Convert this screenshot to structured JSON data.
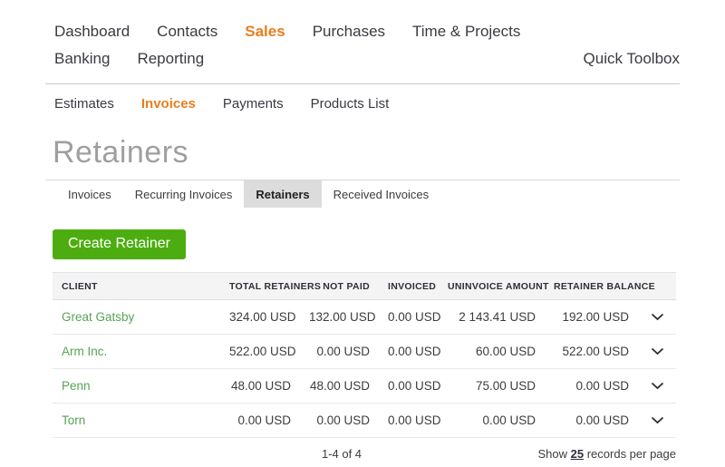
{
  "nav": {
    "row1": [
      {
        "label": "Dashboard",
        "active": false
      },
      {
        "label": "Contacts",
        "active": false
      },
      {
        "label": "Sales",
        "active": true
      },
      {
        "label": "Purchases",
        "active": false
      },
      {
        "label": "Time & Projects",
        "active": false
      }
    ],
    "row2": [
      {
        "label": "Banking",
        "active": false
      },
      {
        "label": "Reporting",
        "active": false
      }
    ],
    "quick_toolbox": "Quick Toolbox"
  },
  "subnav": [
    {
      "label": "Estimates",
      "active": false
    },
    {
      "label": "Invoices",
      "active": true
    },
    {
      "label": "Payments",
      "active": false
    },
    {
      "label": "Products List",
      "active": false
    }
  ],
  "page": {
    "title": "Retainers"
  },
  "tabs": [
    {
      "label": "Invoices",
      "active": false
    },
    {
      "label": "Recurring Invoices",
      "active": false
    },
    {
      "label": "Retainers",
      "active": true
    },
    {
      "label": "Received Invoices",
      "active": false
    }
  ],
  "actions": {
    "create_button": "Create Retainer"
  },
  "table": {
    "columns": {
      "client": "CLIENT",
      "total_retainers": "TOTAL RETAINERS",
      "not_paid": "NOT PAID",
      "invoiced": "INVOICED",
      "uninvoice_amount": "UNINVOICE AMOUNT",
      "retainer_balance": "RETAINER BALANCE"
    },
    "rows": [
      {
        "client": "Great Gatsby",
        "total_retainers": "324.00 USD",
        "not_paid": "132.00 USD",
        "invoiced": "0.00 USD",
        "uninvoice_amount": "2 143.41 USD",
        "retainer_balance": "192.00 USD"
      },
      {
        "client": "Arm Inc.",
        "total_retainers": "522.00 USD",
        "not_paid": "0.00 USD",
        "invoiced": "0.00 USD",
        "uninvoice_amount": "60.00 USD",
        "retainer_balance": "522.00 USD"
      },
      {
        "client": "Penn",
        "total_retainers": "48.00 USD",
        "not_paid": "48.00 USD",
        "invoiced": "0.00 USD",
        "uninvoice_amount": "75.00 USD",
        "retainer_balance": "0.00 USD"
      },
      {
        "client": "Torn",
        "total_retainers": "0.00 USD",
        "not_paid": "0.00 USD",
        "invoiced": "0.00 USD",
        "uninvoice_amount": "0.00 USD",
        "retainer_balance": "0.00 USD"
      }
    ]
  },
  "footer": {
    "range": "1-4 of 4",
    "show_prefix": "Show",
    "per_page": "25",
    "show_suffix": "records per page"
  },
  "colors": {
    "accent_orange": "#e87e1c",
    "button_green": "#4dad10",
    "client_link_green": "#55a455",
    "title_gray": "#9f9f9f",
    "active_tab_bg": "#dcdcdc",
    "header_bg": "#f4f4f4"
  }
}
